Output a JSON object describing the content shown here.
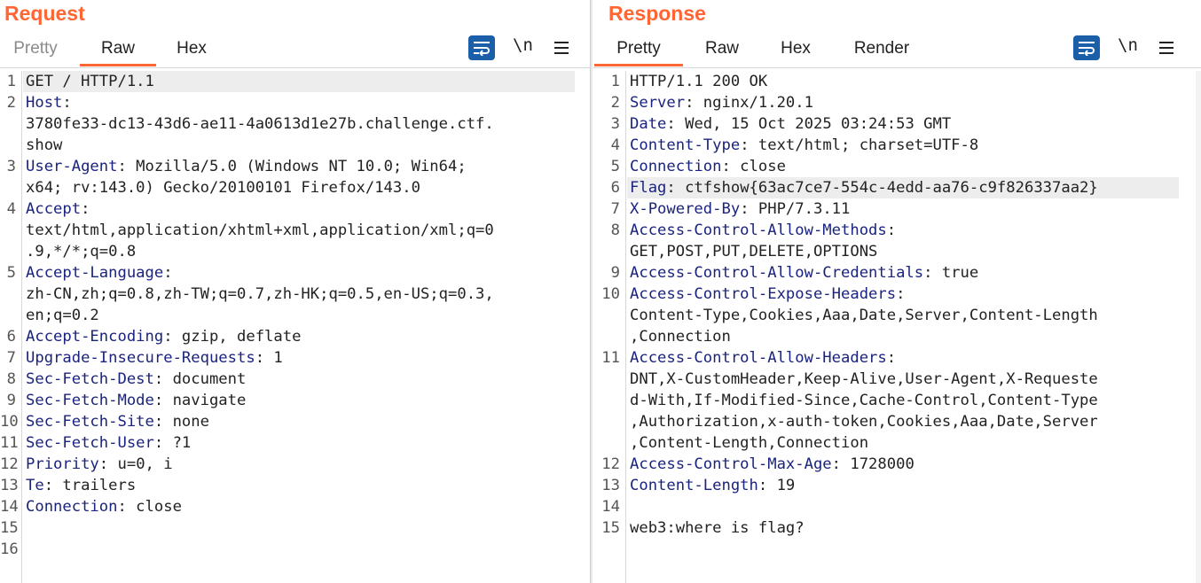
{
  "request": {
    "title": "Request",
    "tabs": [
      {
        "label": "Pretty",
        "active": false
      },
      {
        "label": "Raw",
        "active": true
      },
      {
        "label": "Hex",
        "active": false
      }
    ],
    "newline_toggle": "\\n",
    "line_numbers": [
      "1",
      "2",
      "3",
      "4",
      "5",
      "6",
      "7",
      "8",
      "9",
      "10",
      "11",
      "12",
      "13",
      "14",
      "15",
      "16"
    ],
    "lines": [
      {
        "k": "GET / HTTP/1.1",
        "v": ""
      },
      {
        "k": "Host",
        "v": ":"
      },
      {
        "k": "",
        "v": "3780fe33-dc13-43d6-ae11-4a0613d1e27b.challenge.ctf."
      },
      {
        "k": "",
        "v": "show"
      },
      {
        "k": "User-Agent",
        "v": ": Mozilla/5.0 (Windows NT 10.0; Win64;"
      },
      {
        "k": "",
        "v": "x64; rv:143.0) Gecko/20100101 Firefox/143.0"
      },
      {
        "k": "Accept",
        "v": ":"
      },
      {
        "k": "",
        "v": "text/html,application/xhtml+xml,application/xml;q=0"
      },
      {
        "k": "",
        "v": ".9,*/*;q=0.8"
      },
      {
        "k": "Accept-Language",
        "v": ":"
      },
      {
        "k": "",
        "v": "zh-CN,zh;q=0.8,zh-TW;q=0.7,zh-HK;q=0.5,en-US;q=0.3,"
      },
      {
        "k": "",
        "v": "en;q=0.2"
      },
      {
        "k": "Accept-Encoding",
        "v": ": gzip, deflate"
      },
      {
        "k": "Upgrade-Insecure-Requests",
        "v": ": 1"
      },
      {
        "k": "Sec-Fetch-Dest",
        "v": ": document"
      },
      {
        "k": "Sec-Fetch-Mode",
        "v": ": navigate"
      },
      {
        "k": "Sec-Fetch-Site",
        "v": ": none"
      },
      {
        "k": "Sec-Fetch-User",
        "v": ": ?1"
      },
      {
        "k": "Priority",
        "v": ": u=0, i"
      },
      {
        "k": "Te",
        "v": ": trailers"
      },
      {
        "k": "Connection",
        "v": ": close"
      }
    ]
  },
  "response": {
    "title": "Response",
    "tabs": [
      {
        "label": "Pretty",
        "active": true
      },
      {
        "label": "Raw",
        "active": false
      },
      {
        "label": "Hex",
        "active": false
      },
      {
        "label": "Render",
        "active": false
      }
    ],
    "newline_toggle": "\\n",
    "line_numbers": [
      "1",
      "2",
      "3",
      "4",
      "5",
      "6",
      "7",
      "8",
      "9",
      "10",
      "11",
      "12",
      "13",
      "14",
      "15"
    ],
    "lines": [
      {
        "k": "",
        "v": "HTTP/1.1 200 OK"
      },
      {
        "k": "Server",
        "v": ": nginx/1.20.1"
      },
      {
        "k": "Date",
        "v": ": Wed, 15 Oct 2025 03:24:53 GMT"
      },
      {
        "k": "Content-Type",
        "v": ": text/html; charset=UTF-8"
      },
      {
        "k": "Connection",
        "v": ": close"
      },
      {
        "k": "Flag",
        "v": ": ctfshow{63ac7ce7-554c-4edd-aa76-c9f826337aa2}"
      },
      {
        "k": "X-Powered-By",
        "v": ": PHP/7.3.11"
      },
      {
        "k": "Access-Control-Allow-Methods",
        "v": ":"
      },
      {
        "k": "",
        "v": "GET,POST,PUT,DELETE,OPTIONS"
      },
      {
        "k": "Access-Control-Allow-Credentials",
        "v": ": true"
      },
      {
        "k": "Access-Control-Expose-Headers",
        "v": ":"
      },
      {
        "k": "",
        "v": "Content-Type,Cookies,Aaa,Date,Server,Content-Length"
      },
      {
        "k": "",
        "v": ",Connection"
      },
      {
        "k": "Access-Control-Allow-Headers",
        "v": ":"
      },
      {
        "k": "",
        "v": "DNT,X-CustomHeader,Keep-Alive,User-Agent,X-Requeste"
      },
      {
        "k": "",
        "v": "d-With,If-Modified-Since,Cache-Control,Content-Type"
      },
      {
        "k": "",
        "v": ",Authorization,x-auth-token,Cookies,Aaa,Date,Server"
      },
      {
        "k": "",
        "v": ",Content-Length,Connection"
      },
      {
        "k": "Access-Control-Max-Age",
        "v": ": 1728000"
      },
      {
        "k": "Content-Length",
        "v": ": 19"
      },
      {
        "k": "",
        "v": ""
      },
      {
        "k": "",
        "v": "web3:where is flag?"
      }
    ]
  },
  "colors": {
    "accent": "#ff6633",
    "key": "#1a237e",
    "toolbar_blue": "#1b5fa8"
  }
}
